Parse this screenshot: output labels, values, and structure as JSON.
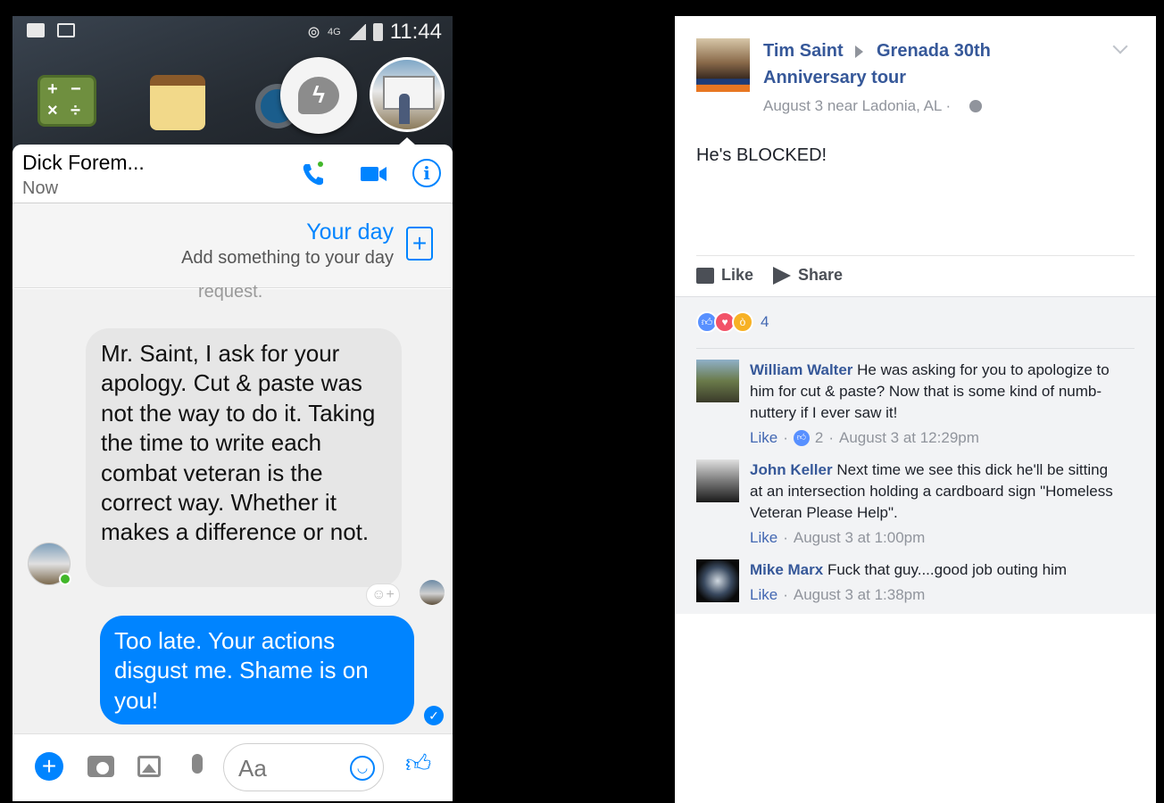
{
  "phone": {
    "status_bar": {
      "network": "4G",
      "time": "11:44"
    },
    "chat": {
      "contact_name": "Dick Forem...",
      "contact_status": "Now",
      "your_day_title": "Your day",
      "your_day_subtitle": "Add something to your day",
      "truncated_text": "request.",
      "incoming_message": "Mr. Saint, I ask for your apology. Cut & paste was not the way to do it. Taking the time to write each combat veteran is the correct way. Whether it makes a difference or not.",
      "outgoing_message": "Too late. Your actions disgust me. Shame is on you!",
      "composer_placeholder": "Aa"
    },
    "accent_color": "#0084ff"
  },
  "post": {
    "author": "Tim Saint",
    "group_line1": "Grenada 30th",
    "group_line2": "Anniversary tour",
    "meta": "August 3 near Ladonia, AL ·",
    "body": "He's BLOCKED!",
    "like_label": "Like",
    "share_label": "Share",
    "reaction_count": "4",
    "comments": [
      {
        "author": "William Walter",
        "text": "He was asking for you to apologize to him for cut & paste? Now that is some kind of numb-nuttery if I ever saw it!",
        "like_label": "Like",
        "sep": "·",
        "likes": "2",
        "time": "August 3 at 12:29pm"
      },
      {
        "author": "John Keller",
        "text": "Next time we see this dick he'll be sitting at an intersection holding a cardboard sign \"Homeless Veteran Please Help\".",
        "like_label": "Like",
        "sep": "·",
        "time": "August 3 at 1:00pm"
      },
      {
        "author": "Mike Marx",
        "text": "Fuck that guy....good job outing him",
        "like_label": "Like",
        "sep": "·",
        "time": "August 3 at 1:38pm"
      }
    ],
    "link_color": "#365899"
  }
}
